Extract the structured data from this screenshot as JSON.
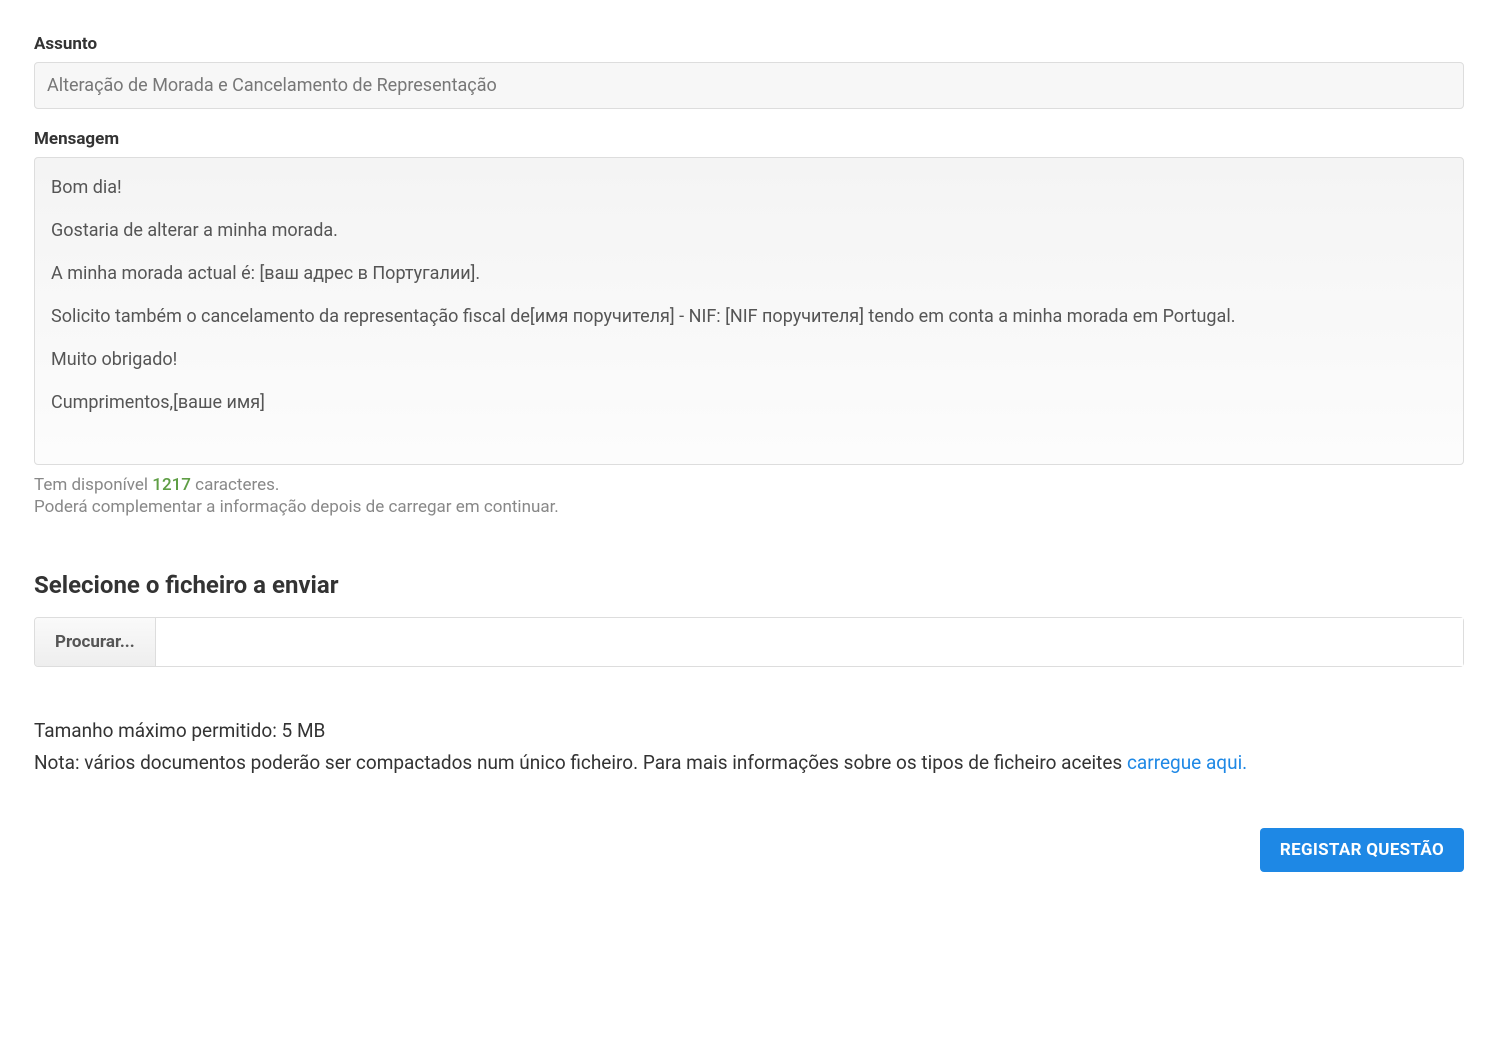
{
  "subject": {
    "label": "Assunto",
    "value": "Alteração de Morada e Cancelamento de Representação"
  },
  "message": {
    "label": "Mensagem",
    "paragraphs": [
      "Bom dia!",
      "Gostaria de alterar a minha morada.",
      "A minha morada actual é: [ваш адрес в Португалии].",
      "Solicito também o cancelamento da representação fiscal de[имя поручителя] - NIF: [NIF поручителя] tendo em conta a minha morada em Portugal.",
      "Muito obrigado!",
      "Cumprimentos,[ваше имя]"
    ]
  },
  "char_info": {
    "prefix": "Tem disponível ",
    "count": "1217",
    "suffix": " caracteres.",
    "note": "Poderá complementar a informação depois de carregar em continuar."
  },
  "file_section": {
    "title": "Selecione o ficheiro a enviar",
    "browse_label": "Procurar...",
    "size_note": "Tamanho máximo permitido: 5 MB",
    "note_prefix": "Nota: vários documentos poderão ser compactados num único ficheiro. Para mais informações sobre os tipos de ficheiro aceites ",
    "link_text": "carregue aqui."
  },
  "submit": {
    "label": "REGISTAR QUESTÃO"
  }
}
